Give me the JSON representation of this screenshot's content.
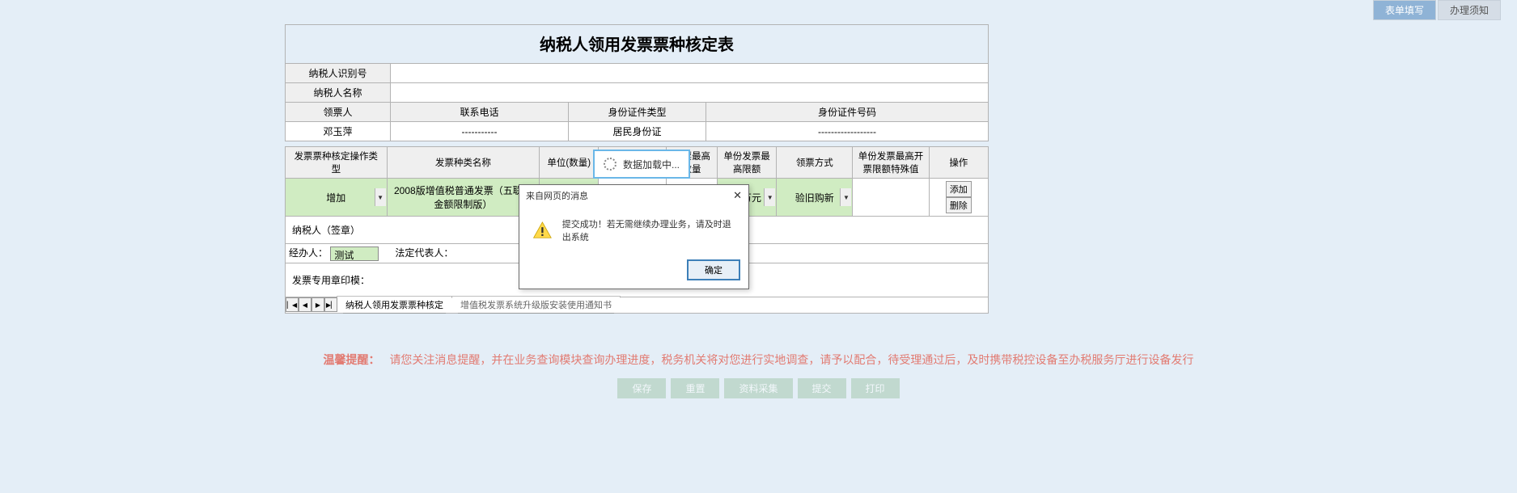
{
  "top_tabs": {
    "form": "表单填写",
    "notice": "办理须知"
  },
  "title": "纳税人领用发票票种核定表",
  "info": {
    "taxpayer_id_label": "纳税人识别号",
    "taxpayer_id": "",
    "taxpayer_name_label": "纳税人名称",
    "taxpayer_name": "",
    "collector_label": "领票人",
    "phone_label": "联系电话",
    "id_type_label": "身份证件类型",
    "id_no_label": "身份证件号码",
    "collector": "邓玉萍",
    "phone": "-----------",
    "id_type": "居民身份证",
    "id_no": "------------------"
  },
  "grid_headers": {
    "op_type": "发票票种核定操作类型",
    "invoice_type": "发票种类名称",
    "unit": "单位(数量)",
    "hold_max": "持票最高数量",
    "per_max_amt": "单份发票最高限额",
    "collect_method": "领票方式",
    "per_max_special": "单份发票最高开票限额特殊值",
    "ops": "操作"
  },
  "row": {
    "op_type": "增加",
    "invoice_type": "2008版增值税普通发票（五联无金额限制版）",
    "unit": "",
    "per_max_amt": "十万元",
    "collect_method": "验旧购新",
    "add_btn": "添加",
    "del_btn": "删除"
  },
  "signature_label": "纳税人（签章）",
  "handler_label": "经办人：",
  "handler_value": "测试",
  "legal_label": "法定代表人：",
  "legal_value": "",
  "stamp_label": "发票专用章印模：",
  "sheets": {
    "tab1": "纳税人领用发票票种核定",
    "tab2": "增值税发票系统升级版安装使用通知书"
  },
  "loading_text": "数据加载中...",
  "modal": {
    "title": "来自网页的消息",
    "body": "提交成功！若无需继续办理业务，请及时退出系统",
    "ok": "确定"
  },
  "footer_tip_label": "温馨提醒：",
  "footer_tip": "请您关注消息提醒，并在业务查询模块查询办理进度，税务机关将对您进行实地调查，请予以配合，待受理通过后，及时携带税控设备至办税服务厅进行设备发行",
  "buttons": {
    "save": "保存",
    "reset": "重置",
    "data": "资料采集",
    "submit": "提交",
    "print": "打印"
  }
}
